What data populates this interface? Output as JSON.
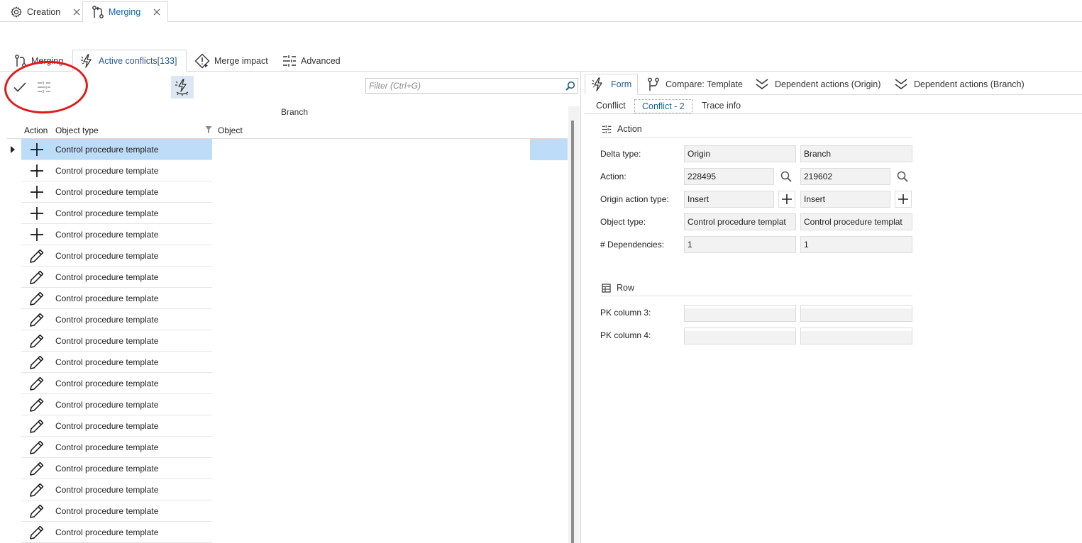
{
  "doc_tabs": [
    {
      "label": "Creation",
      "icon": "gear-icon",
      "active": false
    },
    {
      "label": "Merging",
      "icon": "merge-icon",
      "active": true
    }
  ],
  "sub_tabs": [
    {
      "label": "Merging",
      "icon": "merge-icon"
    },
    {
      "label": "Active conflicts[133]",
      "icon": "conflict-icon",
      "active": true
    },
    {
      "label": "Merge impact",
      "icon": "impact-icon"
    },
    {
      "label": "Advanced",
      "icon": "advanced-icon"
    }
  ],
  "toolbar": {
    "accept_icon": "checkmark-icon",
    "resolve_icon": "resolve-icon",
    "toggle_icon": "conflict-eye-icon"
  },
  "filter": {
    "placeholder": "Filter (Ctrl+G)"
  },
  "grid": {
    "band": "Branch",
    "columns": {
      "action": "Action",
      "object_type": "Object type",
      "object": "Object"
    },
    "rows": [
      {
        "action": "plus-icon",
        "object_type": "Control procedure template",
        "selected": true
      },
      {
        "action": "plus-icon",
        "object_type": "Control procedure template"
      },
      {
        "action": "plus-icon",
        "object_type": "Control procedure template"
      },
      {
        "action": "plus-icon",
        "object_type": "Control procedure template"
      },
      {
        "action": "plus-icon",
        "object_type": "Control procedure template"
      },
      {
        "action": "pencil-icon",
        "object_type": "Control procedure template"
      },
      {
        "action": "pencil-icon",
        "object_type": "Control procedure template"
      },
      {
        "action": "pencil-icon",
        "object_type": "Control procedure template"
      },
      {
        "action": "pencil-icon",
        "object_type": "Control procedure template"
      },
      {
        "action": "pencil-icon",
        "object_type": "Control procedure template"
      },
      {
        "action": "pencil-icon",
        "object_type": "Control procedure template"
      },
      {
        "action": "pencil-icon",
        "object_type": "Control procedure template"
      },
      {
        "action": "pencil-icon",
        "object_type": "Control procedure template"
      },
      {
        "action": "pencil-icon",
        "object_type": "Control procedure template"
      },
      {
        "action": "pencil-icon",
        "object_type": "Control procedure template"
      },
      {
        "action": "pencil-icon",
        "object_type": "Control procedure template"
      },
      {
        "action": "pencil-icon",
        "object_type": "Control procedure template"
      },
      {
        "action": "pencil-icon",
        "object_type": "Control procedure template"
      },
      {
        "action": "pencil-icon",
        "object_type": "Control procedure template"
      }
    ]
  },
  "right_tabs": [
    {
      "label": "Form",
      "icon": "conflict-icon",
      "active": true
    },
    {
      "label": "Compare: Template",
      "icon": "branch-icon"
    },
    {
      "label": "Dependent actions (Origin)",
      "icon": "double-chevron-down-icon"
    },
    {
      "label": "Dependent actions (Branch)",
      "icon": "double-chevron-down-icon"
    }
  ],
  "right_subtabs": [
    {
      "label": "Conflict"
    },
    {
      "label": "Conflict - 2",
      "active": true
    },
    {
      "label": "Trace info"
    }
  ],
  "form": {
    "action_section": "Action",
    "row_section": "Row",
    "labels": {
      "delta_type": "Delta type:",
      "action": "Action:",
      "origin_action_type": "Origin action type:",
      "object_type": "Object type:",
      "dependencies": "# Dependencies:",
      "pk3": "PK column 3:",
      "pk4": "PK column 4:"
    },
    "origin": {
      "delta_type": "Origin",
      "action": "228495",
      "action_type": "Insert",
      "object_type": "Control procedure templat",
      "dependencies": "1"
    },
    "branch": {
      "delta_type": "Branch",
      "action": "219602",
      "action_type": "Insert",
      "object_type": "Control procedure templat",
      "dependencies": "1"
    }
  },
  "colors": {
    "accent": "#1f5d8e",
    "selection": "#bcdcf7",
    "annotation": "#e01b1b"
  }
}
